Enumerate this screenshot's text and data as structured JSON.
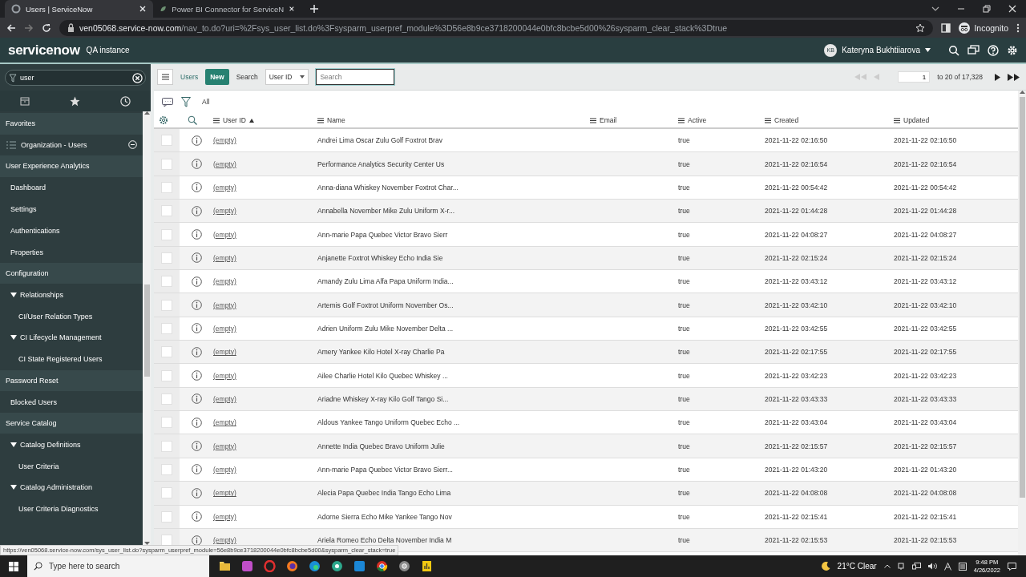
{
  "browser": {
    "tabs": [
      {
        "title": "Users | ServiceNow",
        "selected": true
      },
      {
        "title": "Power BI Connector for ServiceN",
        "selected": false
      }
    ],
    "address": {
      "host": "ven05068.service-now.com",
      "path": "/nav_to.do?uri=%2Fsys_user_list.do%3Fsysparm_userpref_module%3D56e8b9ce3718200044e0bfc8bcbe5d00%26sysparm_clear_stack%3Dtrue"
    },
    "profile": "Incognito"
  },
  "header": {
    "logo": "servicenow",
    "instance": "QA instance",
    "user_initials": "KB",
    "user_name": "Kateryna Bukhtiiarova"
  },
  "sidebar": {
    "filter": "user",
    "items": [
      {
        "label": "Favorites",
        "kind": "section",
        "children": [
          {
            "label": "Organization - Users",
            "kind": "favorite"
          }
        ]
      },
      {
        "label": "User Experience Analytics",
        "kind": "section",
        "children": [
          {
            "label": "Dashboard",
            "kind": "item"
          },
          {
            "label": "Settings",
            "kind": "item"
          },
          {
            "label": "Authentications",
            "kind": "item"
          },
          {
            "label": "Properties",
            "kind": "item"
          }
        ]
      },
      {
        "label": "Configuration",
        "kind": "section",
        "children": [
          {
            "label": "Relationships",
            "kind": "group",
            "expanded": true,
            "children": [
              {
                "label": "CI/User Relation Types",
                "kind": "item"
              }
            ]
          },
          {
            "label": "CI Lifecycle Management",
            "kind": "group",
            "expanded": true,
            "children": [
              {
                "label": "CI State Registered Users",
                "kind": "item"
              }
            ]
          }
        ]
      },
      {
        "label": "Password Reset",
        "kind": "section",
        "children": [
          {
            "label": "Blocked Users",
            "kind": "item"
          }
        ]
      },
      {
        "label": "Service Catalog",
        "kind": "section",
        "children": [
          {
            "label": "Catalog Definitions",
            "kind": "group",
            "expanded": true,
            "children": [
              {
                "label": "User Criteria",
                "kind": "item"
              }
            ]
          },
          {
            "label": "Catalog Administration",
            "kind": "group",
            "expanded": true,
            "children": [
              {
                "label": "User Criteria Diagnostics",
                "kind": "item"
              }
            ]
          }
        ]
      }
    ]
  },
  "list": {
    "title": "Users",
    "new_button": "New",
    "search_label": "Search",
    "search_field": "User ID",
    "search_placeholder": "Search",
    "page": "1",
    "range": "to 20 of 17,328",
    "filter": "All",
    "columns": [
      {
        "label": "User ID",
        "sorted": true
      },
      {
        "label": "Name",
        "sorted": false
      },
      {
        "label": "Email",
        "sorted": false
      },
      {
        "label": "Active",
        "sorted": false
      },
      {
        "label": "Created",
        "sorted": false
      },
      {
        "label": "Updated",
        "sorted": false
      }
    ],
    "rows": [
      {
        "checked": false,
        "user_id": "(empty)",
        "name": "Andrei Lima Oscar Zulu Golf Foxtrot Brav",
        "active": "true",
        "created": "2021-11-22 02:16:50",
        "updated": "2021-11-22 02:16:50"
      },
      {
        "checked": false,
        "user_id": "(empty)",
        "name": "Performance Analytics Security Center Us",
        "active": "true",
        "created": "2021-11-22 02:16:54",
        "updated": "2021-11-22 02:16:54"
      },
      {
        "checked": false,
        "user_id": "(empty)",
        "name": "Anna-diana Whiskey November Foxtrot Char...",
        "active": "true",
        "created": "2021-11-22 00:54:42",
        "updated": "2021-11-22 00:54:42"
      },
      {
        "checked": false,
        "user_id": "(empty)",
        "name": "Annabella November Mike Zulu Uniform X-r...",
        "active": "true",
        "created": "2021-11-22 01:44:28",
        "updated": "2021-11-22 01:44:28"
      },
      {
        "checked": false,
        "user_id": "(empty)",
        "name": "Ann-marie Papa Quebec Victor Bravo Sierr",
        "active": "true",
        "created": "2021-11-22 04:08:27",
        "updated": "2021-11-22 04:08:27"
      },
      {
        "checked": false,
        "user_id": "(empty)",
        "name": "Anjanette Foxtrot Whiskey Echo India Sie",
        "active": "true",
        "created": "2021-11-22 02:15:24",
        "updated": "2021-11-22 02:15:24"
      },
      {
        "checked": false,
        "user_id": "(empty)",
        "name": "Amandy Zulu Lima Alfa Papa Uniform India...",
        "active": "true",
        "created": "2021-11-22 03:43:12",
        "updated": "2021-11-22 03:43:12"
      },
      {
        "checked": false,
        "user_id": "(empty)",
        "name": "Artemis Golf Foxtrot Uniform November Os...",
        "active": "true",
        "created": "2021-11-22 03:42:10",
        "updated": "2021-11-22 03:42:10"
      },
      {
        "checked": false,
        "user_id": "(empty)",
        "name": "Adrien Uniform Zulu Mike November Delta ...",
        "active": "true",
        "created": "2021-11-22 03:42:55",
        "updated": "2021-11-22 03:42:55"
      },
      {
        "checked": false,
        "user_id": "(empty)",
        "name": "Amery Yankee Kilo Hotel X-ray Charlie Pa",
        "active": "true",
        "created": "2021-11-22 02:17:55",
        "updated": "2021-11-22 02:17:55"
      },
      {
        "checked": false,
        "user_id": "(empty)",
        "name": "Ailee Charlie Hotel Kilo Quebec Whiskey ...",
        "active": "true",
        "created": "2021-11-22 03:42:23",
        "updated": "2021-11-22 03:42:23"
      },
      {
        "checked": false,
        "user_id": "(empty)",
        "name": "Ariadne Whiskey X-ray Kilo Golf Tango Si...",
        "active": "true",
        "created": "2021-11-22 03:43:33",
        "updated": "2021-11-22 03:43:33"
      },
      {
        "checked": false,
        "user_id": "(empty)",
        "name": "Aldous Yankee Tango Uniform Quebec Echo ...",
        "active": "true",
        "created": "2021-11-22 03:43:04",
        "updated": "2021-11-22 03:43:04"
      },
      {
        "checked": false,
        "user_id": "(empty)",
        "name": "Annette India Quebec Bravo Uniform Julie",
        "active": "true",
        "created": "2021-11-22 02:15:57",
        "updated": "2021-11-22 02:15:57"
      },
      {
        "checked": false,
        "user_id": "(empty)",
        "name": "Ann-marie Papa Quebec Victor Bravo Sierr...",
        "active": "true",
        "created": "2021-11-22 01:43:20",
        "updated": "2021-11-22 01:43:20"
      },
      {
        "checked": false,
        "user_id": "(empty)",
        "name": "Alecia Papa Quebec India Tango Echo Lima",
        "active": "true",
        "created": "2021-11-22 04:08:08",
        "updated": "2021-11-22 04:08:08"
      },
      {
        "checked": false,
        "user_id": "(empty)",
        "name": "Adorne Sierra Echo Mike Yankee Tango Nov",
        "active": "true",
        "created": "2021-11-22 02:15:41",
        "updated": "2021-11-22 02:15:41"
      },
      {
        "checked": false,
        "user_id": "(empty)",
        "name": "Ariela Romeo Echo Delta November India M",
        "active": "true",
        "created": "2021-11-22 02:15:53",
        "updated": "2021-11-22 02:15:53"
      }
    ]
  },
  "status_url": "https://ven05068.service-now.com/sys_user_list.do?sysparm_userpref_module=56e8b9ce3718200044e0bfc8bcbe5d00&sysparm_clear_stack=true",
  "taskbar": {
    "search_placeholder": "Type here to search",
    "weather": "21°C  Clear",
    "time": "9:48 PM",
    "date": "4/26/2022"
  }
}
